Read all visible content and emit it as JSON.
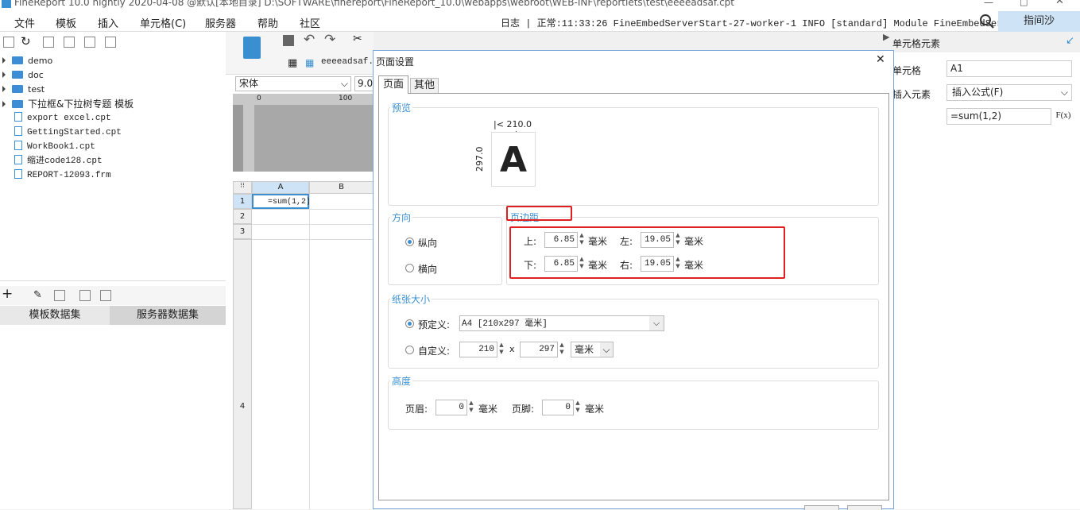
{
  "app": {
    "title": "FineReport 10.0 nightly 2020-04-08 @默认[本地目录]     D:\\SOFTWARE\\finereport\\FineReport_10.0\\webapps\\webroot\\WEB-INF\\reportlets\\test\\eeeeadsaf.cpt"
  },
  "menu": [
    "文件",
    "模板",
    "插入",
    "单元格(C)",
    "服务器",
    "帮助",
    "社区"
  ],
  "status": {
    "text": "日志 | 正常:11:33:26 FineEmbedServerStart-27-worker-1 INFO [standard] Module FineEmbedServerActiv..."
  },
  "user": {
    "name": "指间沙"
  },
  "tree": {
    "folders": [
      "demo",
      "doc",
      "test",
      "下拉框&下拉树专题 模板"
    ],
    "files": [
      "export excel.cpt",
      "GettingStarted.cpt",
      "WorkBook1.cpt",
      "缩进code128.cpt",
      "REPORT-12093.frm"
    ]
  },
  "dataset_tabs": [
    "模板数据集",
    "服务器数据集"
  ],
  "editor": {
    "tab": "eeeeadsaf.c",
    "font": "宋体",
    "font_size": "9.0",
    "ruler_marks": [
      "0",
      "100"
    ],
    "columns": [
      "A",
      "B"
    ],
    "rows": [
      "1",
      "2",
      "3",
      "4"
    ],
    "cell_a1": "=sum(1,2)"
  },
  "right_panel": {
    "title": "单元格元素",
    "cell_label": "单元格",
    "cell_value": "A1",
    "insert_label": "插入元素",
    "insert_value": "插入公式(F)",
    "formula": "=sum(1,2)",
    "fx": "F(x)"
  },
  "dialog": {
    "title": "页面设置",
    "tabs": [
      "页面",
      "其他"
    ],
    "preview": {
      "label": "预览",
      "width": "210.0",
      "height": "297.0",
      "letter": "A"
    },
    "orientation": {
      "label": "方向",
      "portrait": "纵向",
      "landscape": "横向"
    },
    "margins": {
      "label": "页边距",
      "top_label": "上:",
      "top": "6.85",
      "bottom_label": "下:",
      "bottom": "6.85",
      "left_label": "左:",
      "left": "19.05",
      "right_label": "右:",
      "right": "19.05",
      "unit": "毫米"
    },
    "paper": {
      "label": "纸张大小",
      "predefined_label": "预定义:",
      "predefined_value": "A4 [210x297 毫米]",
      "custom_label": "自定义:",
      "custom_w": "210",
      "x": "x",
      "custom_h": "297",
      "unit": "毫米"
    },
    "height": {
      "label": "高度",
      "header_label": "页眉:",
      "header": "0",
      "footer_label": "页脚:",
      "footer": "0",
      "unit": "毫米"
    }
  }
}
